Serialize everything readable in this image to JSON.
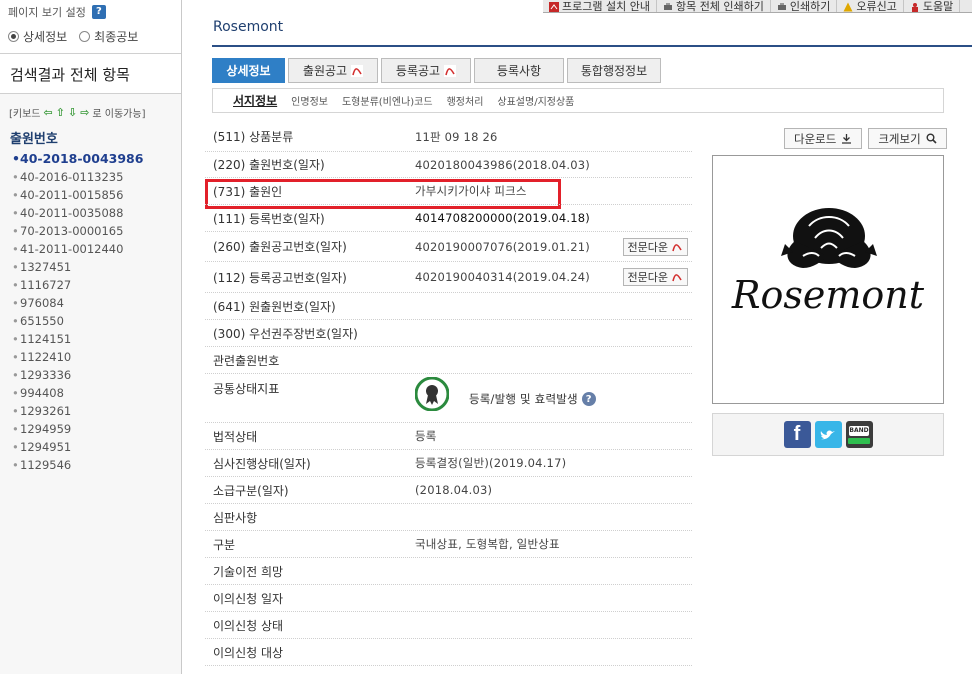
{
  "sidebar": {
    "view_setting_title": "페이지 보기 설정",
    "help": "?",
    "radio_detail": "상세정보",
    "radio_final": "최종공보",
    "search_all": "검색결과 전체 항목",
    "keyboard_hint_prefix": "[키보드",
    "keyboard_hint_suffix": "로 이동가능]",
    "app_no_title": "출원번호",
    "application_numbers": [
      "40-2018-0043986",
      "40-2016-0113235",
      "40-2011-0015856",
      "40-2011-0035088",
      "70-2013-0000165",
      "41-2011-0012440",
      "1327451",
      "1116727",
      "976084",
      "651550",
      "1124151",
      "1122410",
      "1293336",
      "994408",
      "1293261",
      "1294959",
      "1294951",
      "1129546"
    ]
  },
  "toolbar": {
    "install": "프로그램 설치 안내",
    "print_all": "항목 전체 인쇄하기",
    "print": "인쇄하기",
    "report": "오류신고",
    "help": "도움말"
  },
  "main": {
    "title": "Rosemont",
    "tabs": [
      "상세정보",
      "출원공고",
      "등록공고",
      "등록사항",
      "통합행정정보"
    ],
    "subtabs": [
      "서지정보",
      "인명정보",
      "도형분류(비엔나)코드",
      "행정처리",
      "상표설명/지정상품"
    ],
    "rows": [
      {
        "label": "(511) 상품분류",
        "value": "11판      09 18 26"
      },
      {
        "label": "(220) 출원번호(일자)",
        "value": "4020180043986(2018.04.03)"
      },
      {
        "label": "(731) 출원인",
        "value": "가부시키가이샤 피크스"
      },
      {
        "label": "(111) 등록번호(일자)",
        "value": "4014708200000(2019.04.18)"
      },
      {
        "label": "(260) 출원공고번호(일자)",
        "value": "4020190007076(2019.01.21)",
        "button": "전문다운"
      },
      {
        "label": "(112) 등록공고번호(일자)",
        "value": "4020190040314(2019.04.24)",
        "button": "전문다운"
      },
      {
        "label": "(641) 원출원번호(일자)",
        "value": ""
      },
      {
        "label": "(300) 우선권주장번호(일자)",
        "value": ""
      },
      {
        "label": "관련출원번호",
        "value": ""
      },
      {
        "label": "공통상태지표",
        "value": "등록/발행 및 효력발생"
      },
      {
        "label": "법적상태",
        "value": "등록"
      },
      {
        "label": "심사진행상태(일자)",
        "value": "등록결정(일반)(2019.04.17)"
      },
      {
        "label": "소급구분(일자)",
        "value": "(2018.04.03)"
      },
      {
        "label": "심판사항",
        "value": ""
      },
      {
        "label": "구분",
        "value": "국내상표, 도형복합, 일반상표"
      },
      {
        "label": "기술이전 희망",
        "value": ""
      },
      {
        "label": "이의신청 일자",
        "value": ""
      },
      {
        "label": "이의신청 상태",
        "value": ""
      },
      {
        "label": "이의신청 대상",
        "value": ""
      }
    ]
  },
  "image_panel": {
    "download": "다운로드",
    "zoom": "크게보기",
    "logo_text": "Rosemont",
    "band_label": "BAND"
  }
}
